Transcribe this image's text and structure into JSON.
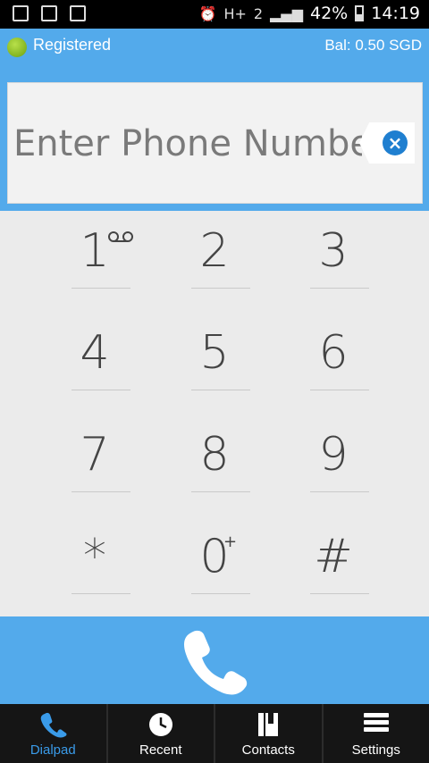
{
  "statusbar": {
    "battery": "42%",
    "time": "14:19",
    "network": "H+",
    "sim": "2"
  },
  "topbar": {
    "status": "Registered",
    "balance": "Bal: 0.50 SGD"
  },
  "input": {
    "placeholder": "Enter Phone Number"
  },
  "keys": [
    {
      "digit": "1",
      "sub": "voicemail"
    },
    {
      "digit": "2"
    },
    {
      "digit": "3"
    },
    {
      "digit": "4"
    },
    {
      "digit": "5"
    },
    {
      "digit": "6"
    },
    {
      "digit": "7"
    },
    {
      "digit": "8"
    },
    {
      "digit": "9"
    },
    {
      "digit": "*"
    },
    {
      "digit": "0",
      "sup": "+"
    },
    {
      "digit": "#"
    }
  ],
  "nav": [
    {
      "label": "Dialpad",
      "icon": "phone-icon",
      "active": true
    },
    {
      "label": "Recent",
      "icon": "clock-icon"
    },
    {
      "label": "Contacts",
      "icon": "contacts-book-icon"
    },
    {
      "label": "Settings",
      "icon": "menu-bars-icon"
    }
  ],
  "colors": {
    "accent": "#53aaeb",
    "active_tab": "#3a9be9",
    "nav_bg": "#151515"
  }
}
